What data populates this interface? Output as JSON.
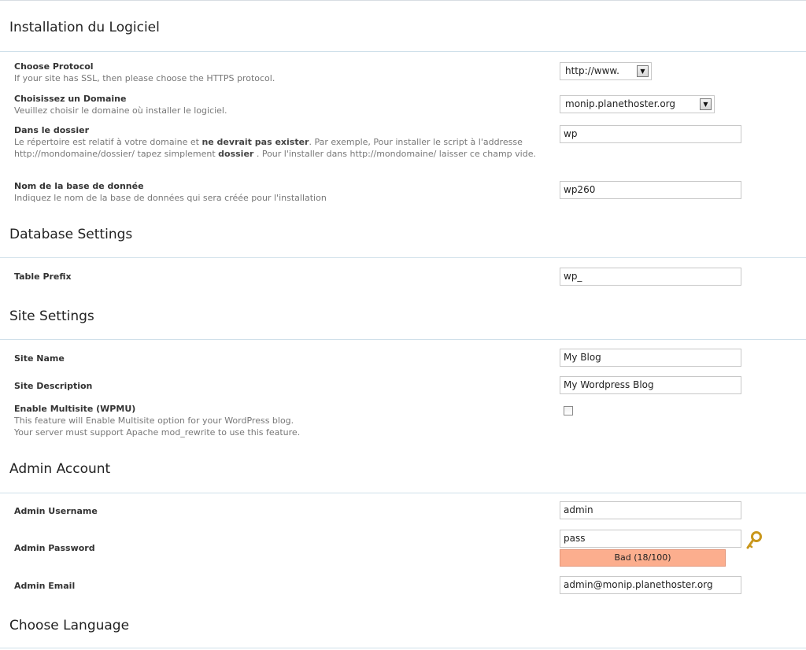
{
  "sections": {
    "install": "Installation du Logiciel",
    "database": "Database Settings",
    "site": "Site Settings",
    "admin": "Admin Account",
    "language": "Choose Language"
  },
  "fields": {
    "protocol": {
      "label": "Choose Protocol",
      "desc": "If your site has SSL, then please choose the HTTPS protocol.",
      "value": "http://www."
    },
    "domain": {
      "label": "Choisissez un Domaine",
      "desc": "Veuillez choisir le domaine où installer le logiciel.",
      "value": "monip.planethoster.org"
    },
    "directory": {
      "label": "Dans le dossier",
      "desc_1": "Le répertoire est relatif à votre domaine et ",
      "desc_bold_1": "ne devrait pas exister",
      "desc_2": ". Par exemple, Pour installer le script à l'addresse http://mondomaine/dossier/ tapez simplement ",
      "desc_bold_2": "dossier",
      "desc_3": " . Pour l'installer dans http://mondomaine/ laisser ce champ vide.",
      "value": "wp"
    },
    "db_name": {
      "label": "Nom de la base de donnée",
      "desc": "Indiquez le nom de la base de données qui sera créée pour l'installation",
      "value": "wp260"
    },
    "table_prefix": {
      "label": "Table Prefix",
      "value": "wp_"
    },
    "site_name": {
      "label": "Site Name",
      "value": "My Blog"
    },
    "site_description": {
      "label": "Site Description",
      "value": "My Wordpress Blog"
    },
    "multisite": {
      "label": "Enable Multisite (WPMU)",
      "desc_1": "This feature will Enable Multisite option for your WordPress blog.",
      "desc_2": "Your server must support Apache mod_rewrite to use this feature.",
      "checked": false
    },
    "admin_username": {
      "label": "Admin Username",
      "value": "admin"
    },
    "admin_password": {
      "label": "Admin Password",
      "value": "pass",
      "strength_text": "Bad (18/100)",
      "strength_color": "#fcae8e"
    },
    "admin_email": {
      "label": "Admin Email",
      "value": "admin@monip.planethoster.org"
    }
  },
  "icons": {
    "password_generate": "key-icon",
    "dropdown": "chevron-down-icon"
  }
}
